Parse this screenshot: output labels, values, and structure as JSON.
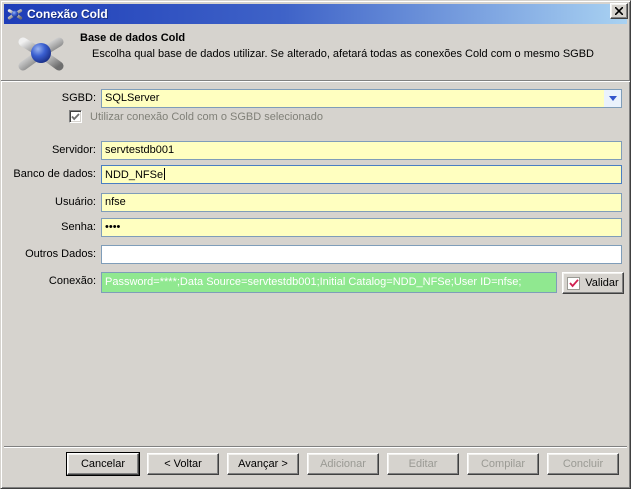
{
  "window": {
    "title": "Conexão Cold"
  },
  "header": {
    "title": "Base de dados Cold",
    "description": "Escolha qual base de dados utilizar. Se alterado, afetará todas as conexões Cold com o mesmo SGBD"
  },
  "form": {
    "sgbd": {
      "label": "SGBD:",
      "value": "SQLServer"
    },
    "use_cold_checkbox": {
      "label": "Utilizar conexão Cold com o SGBD selecionado",
      "checked": true
    },
    "servidor": {
      "label": "Servidor:",
      "value": "servtestdb001"
    },
    "banco_de_dados": {
      "label": "Banco de dados:",
      "value": "NDD_NFSe"
    },
    "usuario": {
      "label": "Usuário:",
      "value": "nfse"
    },
    "senha": {
      "label": "Senha:",
      "value": "••••"
    },
    "outros_dados": {
      "label": "Outros Dados:",
      "value": "",
      "placeholder": ""
    },
    "conexao": {
      "label": "Conexão:",
      "value": "Password=****;Data Source=servtestdb001;Initial Catalog=NDD_NFSe;User ID=nfse;"
    },
    "validar_button": {
      "label": "Validar"
    }
  },
  "footer": {
    "buttons": [
      {
        "label": "Cancelar",
        "enabled": true
      },
      {
        "label": "< Voltar",
        "enabled": true
      },
      {
        "label": "Avançar >",
        "enabled": true
      },
      {
        "label": "Adicionar",
        "enabled": false
      },
      {
        "label": "Editar",
        "enabled": false
      },
      {
        "label": "Compilar",
        "enabled": false
      },
      {
        "label": "Concluir",
        "enabled": false
      }
    ]
  },
  "icons": {
    "window_icon": "jack-molecule-icon",
    "close_icon": "close-x",
    "dropdown_icon": "chevron-down",
    "checkbox_icon": "gray-check",
    "validar_icon": "red-check"
  },
  "colors": {
    "titlebar_left": "#1e3db8",
    "titlebar_right": "#a9d2f2",
    "dialog_bg": "#d6d3ce",
    "field_yellow": "#ffffc0",
    "field_white": "#ffffff",
    "connection_green": "#90e890",
    "connection_text": "#ffffff",
    "field_border": "#7f9db9",
    "disabled_text": "#9a9a94"
  }
}
